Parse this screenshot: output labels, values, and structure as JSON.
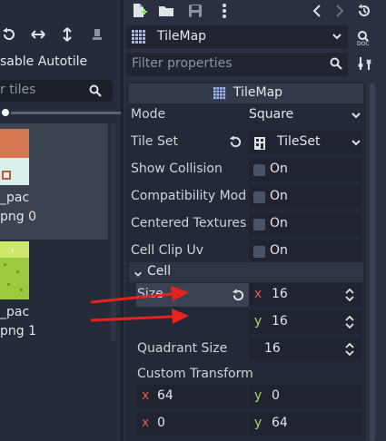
{
  "left": {
    "toolbar_icons": [
      "rotate-left-icon",
      "flip-horizontal-icon",
      "flip-vertical-icon",
      "clear-transform-icon"
    ],
    "autotile_label": "sable Autotile",
    "filter_placeholder": "r tiles",
    "tiles": [
      {
        "name_line1": "_pac",
        "name_line2": "png 0"
      },
      {
        "name_line1": "_pac",
        "name_line2": "png 1"
      }
    ]
  },
  "inspector": {
    "toolbar_icons": [
      "new-resource-icon",
      "open-folder-icon",
      "save-icon",
      "more-vertical-icon",
      "history-back-icon",
      "history-forward-icon",
      "history-icon"
    ],
    "node_picker": {
      "label": "TileMap"
    },
    "filter": {
      "placeholder": "Filter properties"
    },
    "section_title": "TileMap",
    "properties": {
      "mode": {
        "label": "Mode",
        "value": "Square"
      },
      "tile_set": {
        "label": "Tile Set",
        "value": "TileSet"
      },
      "show_collision": {
        "label": "Show Collision",
        "value": "On"
      },
      "compatibility_mode": {
        "label": "Compatibility Mod",
        "value": "On"
      },
      "centered_textures": {
        "label": "Centered Textures",
        "value": "On"
      },
      "cell_clip_uv": {
        "label": "Cell Clip Uv",
        "value": "On"
      }
    },
    "cell": {
      "header": "Cell",
      "size_label": "Size",
      "size_x_axis": "x",
      "size_x": "16",
      "size_y_axis": "y",
      "size_y": "16",
      "quadrant_label": "Quadrant Size",
      "quadrant_value": "16",
      "transform_label": "Custom Transform",
      "transform": {
        "x_axis": "x",
        "y_axis": "y",
        "row1_x": "64",
        "row1_y": "0",
        "row2_x": "0",
        "row2_y": "64"
      }
    }
  },
  "colors": {
    "accent_red": "#e8231e",
    "axis_x": "#e4584c",
    "axis_y": "#a8d86a"
  }
}
